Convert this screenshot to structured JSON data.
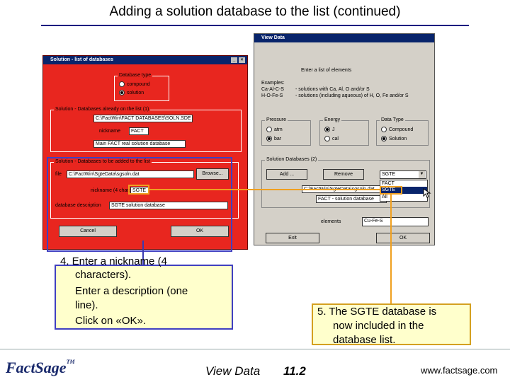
{
  "slide": {
    "title": "Adding a solution database to the list  (continued)",
    "footer_center": "View Data",
    "footer_page": "11.2",
    "footer_url": "www.factsage.com",
    "logo_text": "FactSage",
    "logo_tm": "TM"
  },
  "left_dialog": {
    "title": "Solution - list of databases",
    "db_type_group": "Database type",
    "db_type_options": [
      "compound",
      "solution"
    ],
    "db_type_selected": "solution",
    "already_group": "Solution - Databases already on the list (1)",
    "already_path": "C:\\FactWin\\FACT DATABASES\\SOLN.SDE",
    "nickname_label": "nickname",
    "nickname_value": "FACT",
    "description_value": "Main FACT real solution database",
    "add_group": "Solution - Databases to be added to the list",
    "file_label": "file",
    "file_value": "C:\\FactWin\\SgteData\\sgsoln.dat",
    "browse_label": "Browse...",
    "nick4_label": "nickname (4 chars)",
    "nick4_value": "SGTE",
    "desc_label": "database description",
    "desc_value": "SGTE solution database",
    "cancel_label": "Cancel",
    "ok_label": "OK"
  },
  "right_dialog": {
    "title": "View Data",
    "prompt": "Enter a list of elements",
    "examples_label": "Examples:",
    "example1_key": "Ca-Al-C-S",
    "example1_text": "- solutions with Ca, Al, O and/or S",
    "example2_key": "H-O-Fe-S",
    "example2_text": "- solutions (including aqueous) of H, O, Fe and/or S",
    "pressure_group": "Pressure",
    "pressure_options": [
      "atm",
      "bar"
    ],
    "pressure_selected": "bar",
    "energy_group": "Energy",
    "energy_options": [
      "J",
      "cal"
    ],
    "energy_selected": "J",
    "datatype_group": "Data Type",
    "datatype_options": [
      "Compound",
      "Solution"
    ],
    "datatype_selected": "Solution",
    "soln_group": "Solution Databases (2)",
    "add_label": "Add ...",
    "remove_label": "Remove",
    "combo_value": "SGTE",
    "list_rows": [
      "C:\\FactWin\\SgteData\\sgsoln.dat",
      "FACT - solution database"
    ],
    "dropdown_items": [
      "FACT",
      "SGTE",
      "All"
    ],
    "dropdown_selected": "SGTE",
    "elements_label": "elements",
    "elements_value": "Cu-Fe-S",
    "exit_label": "Exit",
    "ok_label": "OK"
  },
  "callouts": {
    "step4_lines": [
      "4.  Enter a nickname (4",
      "characters).",
      "Enter a description (one",
      "line).",
      "Click on «OK»."
    ],
    "step5_lines": [
      "5.  The SGTE database is",
      "now included in the",
      "database list."
    ]
  },
  "colors": {
    "left_dialog_bg": "#e8261f",
    "titlebar": "#08246b",
    "callout_bg": "#ffffcc",
    "callout4_border": "#4040c0",
    "callout5_border": "#d4a020",
    "connector_orange": "#f0a020",
    "connector_blue": "#3a3ab0"
  }
}
